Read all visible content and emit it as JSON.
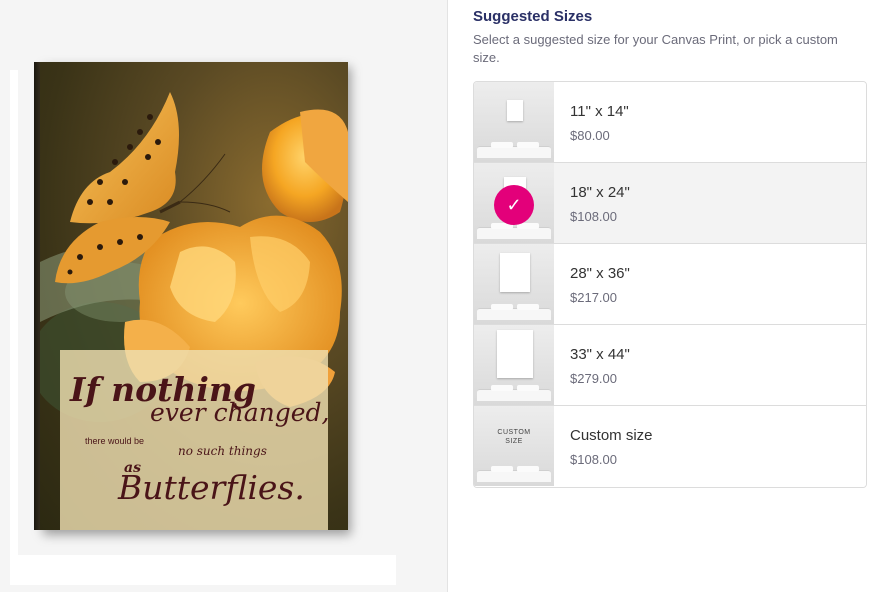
{
  "preview": {
    "quote_lines": [
      "If nothing",
      "ever changed,",
      "there would be",
      "no such things",
      "as",
      "Butterflies."
    ]
  },
  "suggested_sizes": {
    "title": "Suggested Sizes",
    "subtitle": "Select a suggested size for your Canvas Print, or pick a custom size.",
    "options": [
      {
        "name": "11\" x 14\"",
        "price": "$80.00",
        "selected": false
      },
      {
        "name": "18\" x 24\"",
        "price": "$108.00",
        "selected": true
      },
      {
        "name": "28\" x 36\"",
        "price": "$217.00",
        "selected": false
      },
      {
        "name": "33\" x 44\"",
        "price": "$279.00",
        "selected": false
      },
      {
        "name": "Custom size",
        "price": "$108.00",
        "selected": false,
        "thumb_label": "CUSTOM\nSIZE"
      }
    ],
    "selected_check_icon": "check-icon",
    "accent_color": "#e3007a"
  }
}
